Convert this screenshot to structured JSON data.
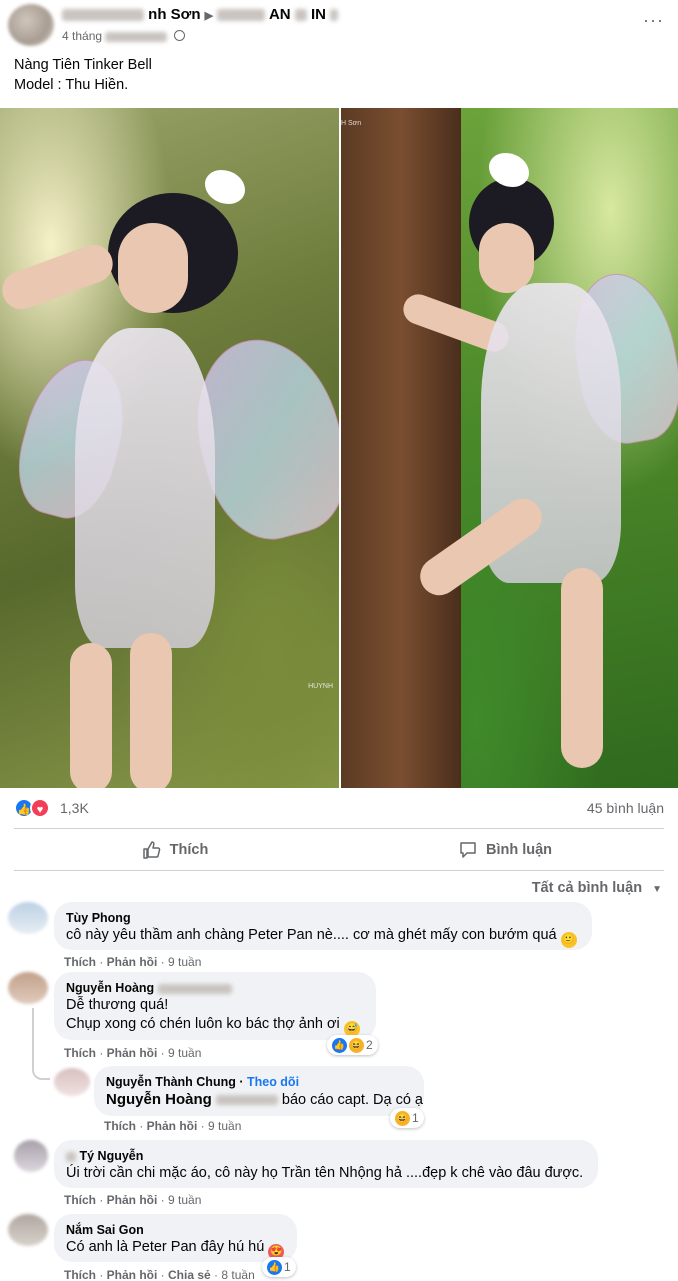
{
  "post": {
    "author_visible": "nh Sơn",
    "group_visible": "AN",
    "group_tail": "IN",
    "time_prefix": "4 tháng",
    "text_line1": "Nàng Tiên Tinker Bell",
    "text_line2": "Model : Thu Hiền.",
    "more": "···"
  },
  "photos": {
    "left_watermark": "HUYNH",
    "right_watermark": "H Sơn"
  },
  "stats": {
    "like_glyph": "👍",
    "love_glyph": "♥",
    "reaction_count": "1,3K",
    "comment_count": "45 bình luận"
  },
  "actions": {
    "like_label": "Thích",
    "comment_label": "Bình luận"
  },
  "sort_label": "Tất cả bình luận",
  "comments": [
    {
      "name": "Tùy Phong",
      "text": "cô này yêu thầm anh chàng Peter Pan nè.... cơ mà ghét mấy con bướm quá",
      "like": "Thích",
      "reply": "Phản hồi",
      "time": "9 tuần"
    },
    {
      "name": "Nguyễn Hoàng",
      "text1": "Dễ thương quá!",
      "text2": "Chụp xong có chén luôn ko bác thợ ảnh ơi",
      "like": "Thích",
      "reply": "Phản hồi",
      "time": "9 tuần",
      "reaction_count": "2"
    },
    {
      "name": "Nguyễn Thành Chung",
      "follow": "Theo dõi",
      "mention": "Nguyễn Hoàng",
      "text": "báo cáo capt. Dạ có ạ",
      "like": "Thích",
      "reply": "Phản hồi",
      "time": "9 tuần",
      "reaction_count": "1"
    },
    {
      "name": "Tý Nguyễn",
      "text": "Úi trời cần chi mặc áo, cô này họ Trần tên Nhộng hả ....đẹp k chê vào đâu được.",
      "like": "Thích",
      "reply": "Phản hồi",
      "time": "9 tuần"
    },
    {
      "name": "Nắm Sai Gon",
      "text": "Có anh là Peter Pan đây hú hú",
      "like": "Thích",
      "reply": "Phản hồi",
      "share": "Chia sẻ",
      "time": "8 tuần",
      "reaction_count": "1"
    }
  ],
  "colors": {
    "accent": "#1877f2",
    "love": "#f33e58",
    "bubble": "#f0f2f5",
    "muted_text": "#65676b"
  }
}
